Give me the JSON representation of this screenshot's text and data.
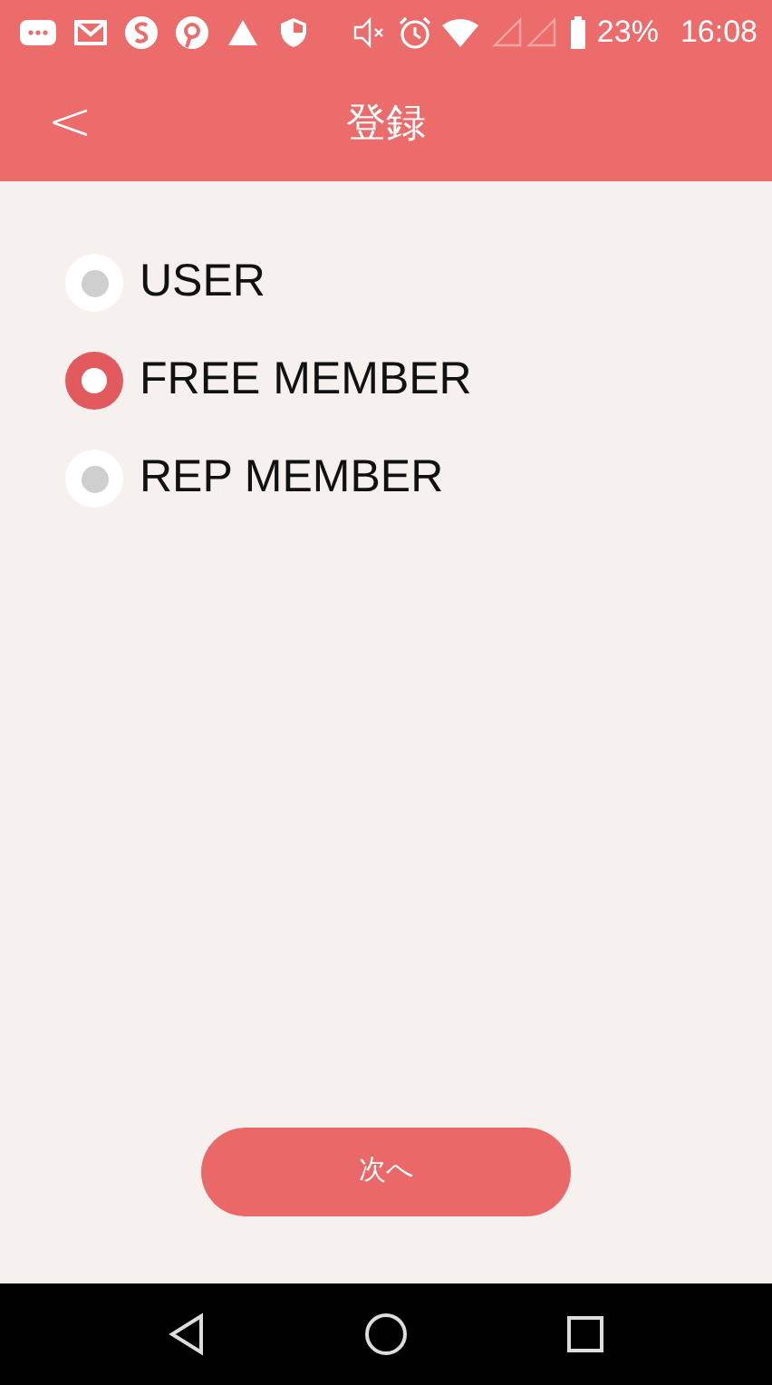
{
  "status_bar": {
    "battery": "23%",
    "time": "16:08"
  },
  "app_bar": {
    "back": "<",
    "title": "登録"
  },
  "options": [
    {
      "label": "USER",
      "selected": false
    },
    {
      "label": "FREE MEMBER",
      "selected": true
    },
    {
      "label": "REP MEMBER",
      "selected": false
    }
  ],
  "next_button": "次へ"
}
